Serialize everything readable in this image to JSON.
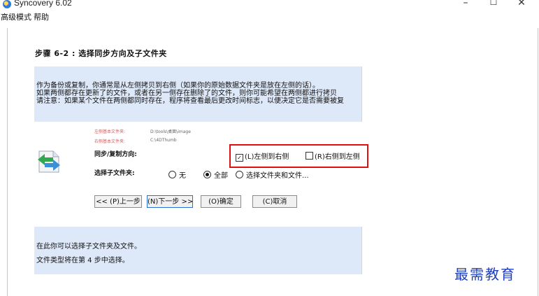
{
  "window": {
    "title": "Syncovery 6.02",
    "minimize": "–",
    "maximize": "☐",
    "close": "✕"
  },
  "menu": [
    "高级模式",
    "帮助"
  ],
  "step_title": "步骤 6-2 : 选择同步方向及子文件夹",
  "info": {
    "lines": [
      "作为备份或复制，你通常是从左侧拷贝到右侧（如果你的原始数据文件夹是放在左侧的话）。",
      "如果两侧都存在更新了的文件，或者在另一侧存在删除了的文件，则你可能希望在两侧都进行拷贝",
      "请注意：如果某个文件在两侧都同时存在，程序将查看最后更改时间标志，以便决定它是否需要被复"
    ]
  },
  "paths": {
    "left_label": "左侧基本文件夹:",
    "left_value": "D:\\tools\\桌面\\image",
    "right_label": "右侧基本文件夹:",
    "right_value": "C:\\4DThumb"
  },
  "direction": {
    "label": "同步/复制方向:",
    "left_to_right": "(L)左侧到右侧",
    "left_to_right_checked": true,
    "right_to_left": "(R)右侧到左侧",
    "right_to_left_checked": false
  },
  "subfolders": {
    "label": "选择子文件夹:",
    "options": [
      "无",
      "全部",
      "选择文件夹和文件..."
    ],
    "selected": "全部"
  },
  "buttons": {
    "prev": "<< (P)上一步",
    "next": "(N)下一步 >>",
    "ok": "(O)确定",
    "cancel": "(C)取消"
  },
  "info2": {
    "lines": [
      "在此你可以选择子文件夹及文件。",
      "文件类型将在第 4 步中选择。"
    ]
  },
  "watermark": "最需教育",
  "colors": {
    "info_bg": "#dde8f9",
    "highlight": "#e01010",
    "watermark": "#1f3fbf"
  }
}
